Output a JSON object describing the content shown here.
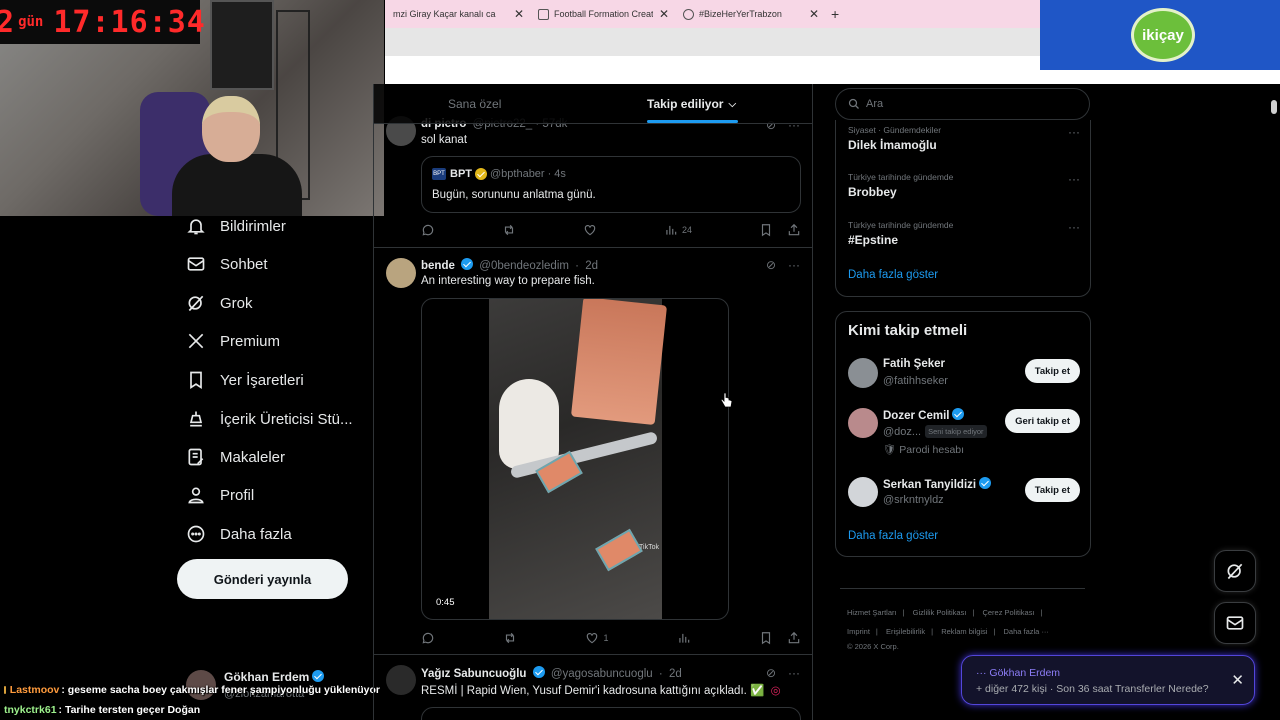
{
  "browser": {
    "tabs": [
      {
        "title": "mzi Giray Kaçar kanalı ca"
      },
      {
        "title": "Football Formation Creator: Re"
      },
      {
        "title": "#BizeHerYerTrabzon"
      }
    ],
    "new_tab": "+"
  },
  "ad": {
    "logo_text": "ikiçay"
  },
  "webcam": {
    "days": "2",
    "days_label": "gün",
    "time": "17:16:34"
  },
  "nav": {
    "items": [
      {
        "label": "Bildirimler",
        "icon": "bell-icon"
      },
      {
        "label": "Sohbet",
        "icon": "mail-icon"
      },
      {
        "label": "Grok",
        "icon": "grok-icon"
      },
      {
        "label": "Premium",
        "icon": "x-logo-icon"
      },
      {
        "label": "Yer İşaretleri",
        "icon": "bookmark-icon"
      },
      {
        "label": "İçerik Üreticisi Stü...",
        "icon": "creator-icon"
      },
      {
        "label": "Makaleler",
        "icon": "article-icon"
      },
      {
        "label": "Profil",
        "icon": "person-icon"
      },
      {
        "label": "Daha fazla",
        "icon": "more-circle-icon"
      }
    ],
    "post_button": "Gönderi yayınla",
    "account": {
      "name": "Gökhan Erdem",
      "handle": "@zlonzamarotta"
    }
  },
  "chat": [
    {
      "user": "Lastmoov",
      "message": ": geseme sacha boey çakmışlar fener şampiyonluğu yüklenüyor"
    },
    {
      "user": "tnykctrk61",
      "message": ": Tarihe tersten geçer Doğan"
    }
  ],
  "timeline": {
    "tabs": {
      "for_you": "Sana özel",
      "following": "Takip ediliyor"
    },
    "posts": [
      {
        "name": "di pietro",
        "handle": "@pietro22_ · 57dk",
        "text": "sol kanat",
        "quote": {
          "name": "BPT",
          "handle": "@bpthaber",
          "time": "4s",
          "text": "Bugün, sorununu anlatma günü."
        },
        "views": "24"
      },
      {
        "name": "bende",
        "handle": "@0bendeozledim",
        "time": "2d",
        "text": "An interesting way to prepare fish.",
        "video_duration": "0:45",
        "video_watermark": "TikTok",
        "likes": "1"
      },
      {
        "name": "Yağız Sabuncuoğlu",
        "handle": "@yagosabuncuoglu",
        "time": "2d",
        "text": "RESMİ | Rapid Wien, Yusuf Demir'i kadrosuna kattığını açıkladı. ✅"
      }
    ]
  },
  "search": {
    "placeholder": "Ara"
  },
  "trends": {
    "items": [
      {
        "category": "Siyaset · Gündemdekiler",
        "name": "Dilek İmamoğlu"
      },
      {
        "category": "Türkiye tarihinde gündemde",
        "name": "Brobbey"
      },
      {
        "category": "Türkiye tarihinde gündemde",
        "name": "#Epstine"
      }
    ],
    "show_more": "Daha fazla göster"
  },
  "who_to_follow": {
    "title": "Kimi takip etmeli",
    "items": [
      {
        "name": "Fatih Şeker",
        "handle": "@fatihhseker",
        "button": "Takip et"
      },
      {
        "name": "Dozer Cemil",
        "handle": "@doz...",
        "tag": "Seni takip ediyor",
        "note": "Parodi hesabı",
        "button": "Geri takip et"
      },
      {
        "name": "Serkan Tanyildizi",
        "handle": "@srkntnyldz",
        "button": "Takip et"
      }
    ],
    "show_more": "Daha fazla göster"
  },
  "footer": {
    "links": [
      "Hizmet Şartları",
      "Gizlilik Politikası",
      "Çerez Politikası",
      "Imprint",
      "Erişilebilirlik",
      "Reklam bilgisi",
      "Daha fazla ···"
    ],
    "copyright": "© 2026 X Corp."
  },
  "alert": {
    "name": "Gökhan Erdem",
    "text": "+ diğer 472 kişi · Son 36 saat Transferler Nerede?"
  }
}
